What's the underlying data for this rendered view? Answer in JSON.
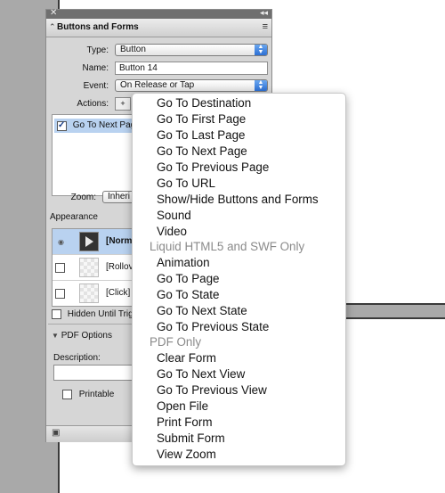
{
  "panel": {
    "title": "Buttons and Forms",
    "type_label": "Type:",
    "type_value": "Button",
    "name_label": "Name:",
    "name_value": "Button 14",
    "event_label": "Event:",
    "event_value": "On Release or Tap",
    "actions_label": "Actions:",
    "action_items": [
      "Go To Next Pag"
    ],
    "zoom_label": "Zoom:",
    "zoom_value": "Inheri",
    "appearance_label": "Appearance",
    "appearance_states": [
      "[Norma",
      "[Rollove",
      "[Click]"
    ],
    "hidden_label": "Hidden Until Trigg",
    "pdf_options_label": "PDF Options",
    "description_label": "Description:",
    "printable_label": "Printable"
  },
  "dropdown": {
    "groups": [
      {
        "items": [
          "Go To Destination",
          "Go To First Page",
          "Go To Last Page",
          "Go To Next Page",
          "Go To Previous Page",
          "Go To URL",
          "Show/Hide Buttons and Forms",
          "Sound",
          "Video"
        ]
      },
      {
        "header": "Liquid HTML5 and SWF Only",
        "items": [
          "Animation",
          "Go To Page",
          "Go To State",
          "Go To Next State",
          "Go To Previous State"
        ]
      },
      {
        "header": "PDF Only",
        "items": [
          "Clear Form",
          "Go To Next View",
          "Go To Previous View",
          "Open File",
          "Print Form",
          "Submit Form",
          "View Zoom"
        ]
      }
    ]
  },
  "colors": {
    "panel_bg": "#d6d6d6",
    "selection": "#b9d2f0",
    "select_arrow": "#2c6fd3"
  }
}
